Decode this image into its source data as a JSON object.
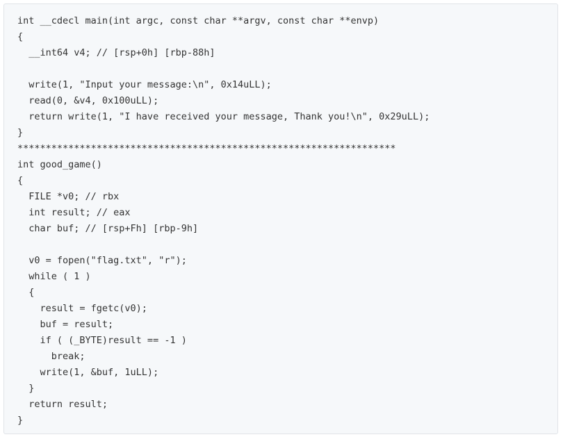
{
  "code": {
    "lines": [
      "int __cdecl main(int argc, const char **argv, const char **envp)",
      "{",
      "  __int64 v4; // [rsp+0h] [rbp-88h]",
      "",
      "  write(1, \"Input your message:\\n\", 0x14uLL);",
      "  read(0, &v4, 0x100uLL);",
      "  return write(1, \"I have received your message, Thank you!\\n\", 0x29uLL);",
      "}",
      "*******************************************************************",
      "int good_game()",
      "{",
      "  FILE *v0; // rbx",
      "  int result; // eax",
      "  char buf; // [rsp+Fh] [rbp-9h]",
      "",
      "  v0 = fopen(\"flag.txt\", \"r\");",
      "  while ( 1 )",
      "  {",
      "    result = fgetc(v0);",
      "    buf = result;",
      "    if ( (_BYTE)result == -1 )",
      "      break;",
      "    write(1, &buf, 1uLL);",
      "  }",
      "  return result;",
      "}"
    ]
  }
}
